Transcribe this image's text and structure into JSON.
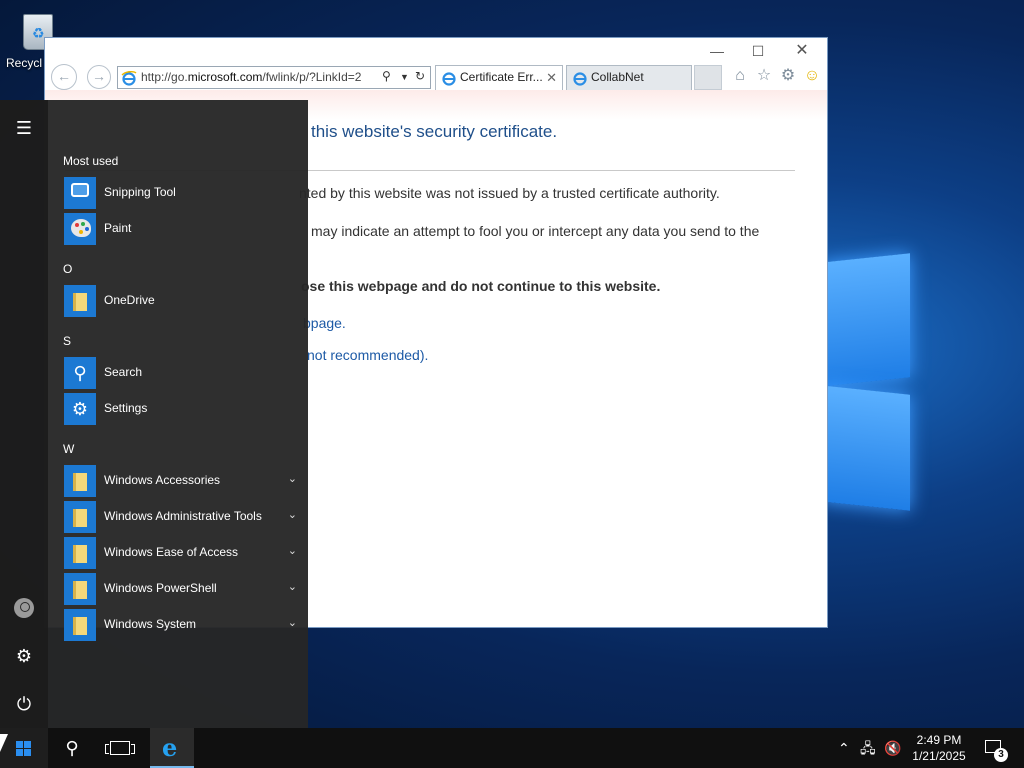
{
  "desktop": {
    "recycle_bin_label": "Recycl"
  },
  "ie": {
    "url_prefix": "http://go.",
    "url_domain": "microsoft.com",
    "url_suffix": "/fwlink/p/?LinkId=2",
    "tabs": [
      {
        "label": "Certificate Err...",
        "active": true
      },
      {
        "label": "CollabNet",
        "active": false
      }
    ],
    "content": {
      "title": "this website's security certificate.",
      "line1": "nted by this website was not issued by a trusted certificate authority.",
      "line2": "may indicate an attempt to fool you or intercept any data you send to the",
      "line3": "ose this webpage and do not continue to this website.",
      "link1": "bpage.",
      "link2": "not recommended)."
    }
  },
  "start_menu": {
    "most_used_header": "Most used",
    "most_used": [
      {
        "name": "Snipping Tool"
      },
      {
        "name": "Paint"
      }
    ],
    "group_o": "O",
    "group_o_items": [
      {
        "name": "OneDrive"
      }
    ],
    "group_s": "S",
    "group_s_items": [
      {
        "name": "Search"
      },
      {
        "name": "Settings"
      }
    ],
    "group_w": "W",
    "group_w_items": [
      {
        "name": "Windows Accessories"
      },
      {
        "name": "Windows Administrative Tools"
      },
      {
        "name": "Windows Ease of Access"
      },
      {
        "name": "Windows PowerShell"
      },
      {
        "name": "Windows System"
      }
    ]
  },
  "taskbar": {
    "time": "2:49 PM",
    "date": "1/21/2025",
    "notification_count": "3"
  },
  "colors": {
    "accent": "#1c79d3",
    "link": "#1d5aa6",
    "title_blue": "#1f4f8a"
  },
  "icons": [
    "recycle-bin-icon",
    "back-icon",
    "forward-icon",
    "search-icon",
    "refresh-icon",
    "home-icon",
    "star-icon",
    "gear-icon",
    "smiley-icon",
    "hamburger-icon",
    "user-icon",
    "power-icon",
    "windows-icon",
    "task-view-icon",
    "ie-icon",
    "network-icon",
    "volume-muted-icon",
    "notification-icon"
  ]
}
